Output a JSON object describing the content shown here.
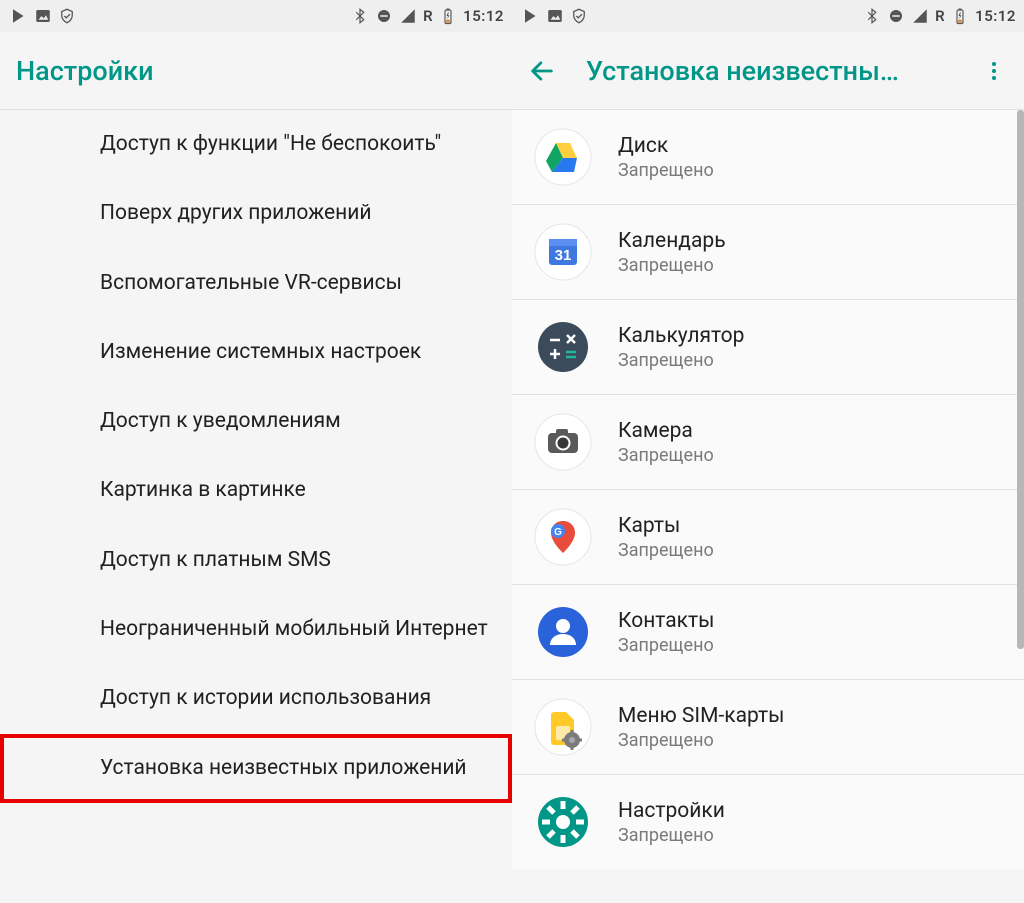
{
  "status": {
    "time": "15:12",
    "roaming": "R"
  },
  "left": {
    "title": "Настройки",
    "items": [
      "Доступ к функции \"Не беспокоить\"",
      "Поверх других приложений",
      "Вспомогательные VR-сервисы",
      "Изменение системных настроек",
      "Доступ к уведомлениям",
      "Картинка в картинке",
      "Доступ к платным SMS",
      "Неограниченный мобильный Интернет",
      "Доступ к истории использования",
      "Установка неизвестных приложений"
    ]
  },
  "right": {
    "title": "Установка неизвестны…",
    "apps": [
      {
        "name": "Диск",
        "status": "Запрещено",
        "icon": "drive"
      },
      {
        "name": "Календарь",
        "status": "Запрещено",
        "icon": "calendar"
      },
      {
        "name": "Калькулятор",
        "status": "Запрещено",
        "icon": "calculator"
      },
      {
        "name": "Камера",
        "status": "Запрещено",
        "icon": "camera"
      },
      {
        "name": "Карты",
        "status": "Запрещено",
        "icon": "maps"
      },
      {
        "name": "Контакты",
        "status": "Запрещено",
        "icon": "contacts"
      },
      {
        "name": "Меню SIM-карты",
        "status": "Запрещено",
        "icon": "sim"
      },
      {
        "name": "Настройки",
        "status": "Запрещено",
        "icon": "settings"
      }
    ]
  }
}
